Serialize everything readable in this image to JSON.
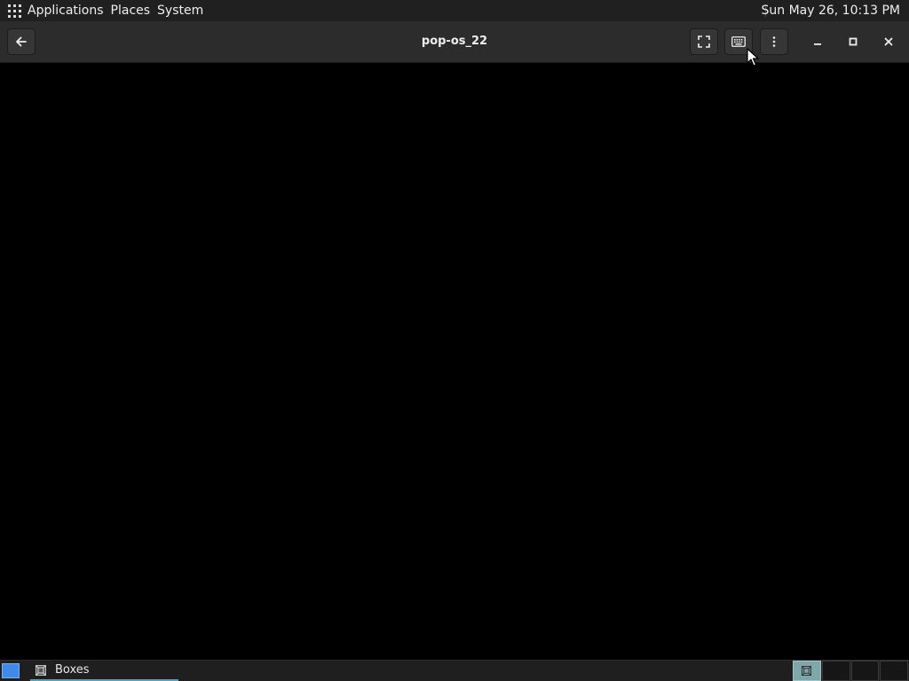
{
  "top_panel": {
    "menus": [
      {
        "label": "Applications"
      },
      {
        "label": "Places"
      },
      {
        "label": "System"
      }
    ],
    "clock": "Sun May 26, 10:13 PM"
  },
  "window": {
    "title": "pop-os_22",
    "buttons": {
      "back": "back-arrow-icon",
      "fullscreen": "fullscreen-icon",
      "keyboard": "keyboard-icon",
      "menu": "vertical-dots-icon",
      "minimize": "minimize-icon",
      "maximize": "maximize-icon",
      "close": "close-icon"
    }
  },
  "taskbar": {
    "items": [
      {
        "label": "Boxes",
        "icon": "boxes-app-icon",
        "active": true
      }
    ],
    "workspaces": [
      {
        "active": true
      },
      {
        "active": false
      },
      {
        "active": false
      },
      {
        "active": false
      }
    ]
  },
  "colors": {
    "panel_bg": "#202020",
    "headerbar_bg": "#2c2c2c",
    "display_bg": "#000000",
    "accent": "#47a9c9",
    "show_desktop": "#3f8ae8"
  }
}
